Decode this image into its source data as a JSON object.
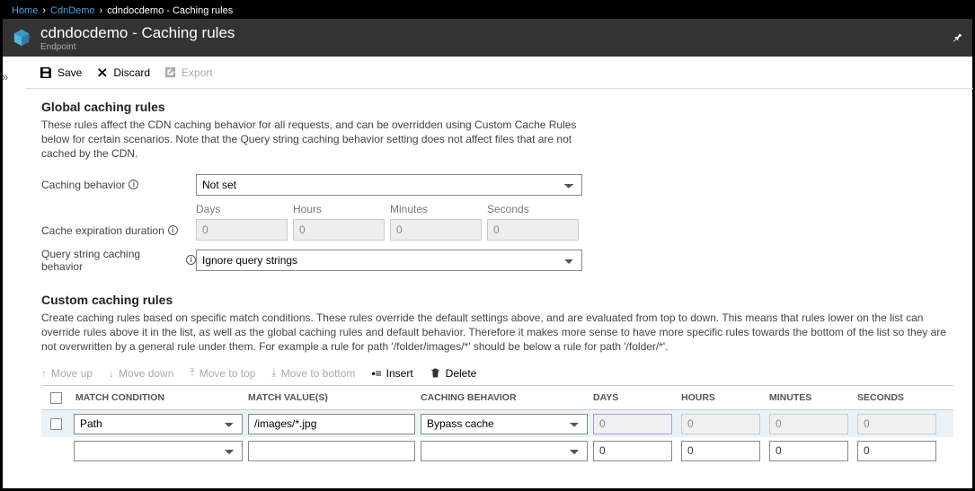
{
  "breadcrumb": {
    "home": "Home",
    "profile": "CdnDemo",
    "current": "cdndocdemo - Caching rules"
  },
  "header": {
    "title": "cdndocdemo - Caching rules",
    "subtitle": "Endpoint"
  },
  "toolbar": {
    "save": "Save",
    "discard": "Discard",
    "export": "Export"
  },
  "global": {
    "title": "Global caching rules",
    "desc": "These rules affect the CDN caching behavior for all requests, and can be overridden using Custom Cache Rules below for certain scenarios. Note that the Query string caching behavior setting does not affect files that are not cached by the CDN.",
    "caching_behavior_label": "Caching behavior",
    "caching_behavior_value": "Not set",
    "expiration_label": "Cache expiration duration",
    "duration_headers": {
      "days": "Days",
      "hours": "Hours",
      "minutes": "Minutes",
      "seconds": "Seconds"
    },
    "duration_values": {
      "days": "0",
      "hours": "0",
      "minutes": "0",
      "seconds": "0"
    },
    "query_label": "Query string caching behavior",
    "query_value": "Ignore query strings"
  },
  "custom": {
    "title": "Custom caching rules",
    "desc": "Create caching rules based on specific match conditions. These rules override the default settings above, and are evaluated from top to down. This means that rules lower on the list can override rules above it in the list, as well as the global caching rules and default behavior. Therefore it makes more sense to have more specific rules towards the bottom of the list so they are not overwritten by a general rule under them. For example a rule for path '/folder/images/*' should be below a rule for path '/folder/*'.",
    "buttons": {
      "move_up": "Move up",
      "move_down": "Move down",
      "move_top": "Move to top",
      "move_bottom": "Move to bottom",
      "insert": "Insert",
      "delete": "Delete"
    },
    "columns": {
      "match_condition": "MATCH CONDITION",
      "match_values": "MATCH VALUE(S)",
      "caching_behavior": "CACHING BEHAVIOR",
      "days": "DAYS",
      "hours": "HOURS",
      "minutes": "MINUTES",
      "seconds": "SECONDS"
    },
    "rows": [
      {
        "match_condition": "Path",
        "match_value": "/images/*.jpg",
        "caching_behavior": "Bypass cache",
        "days": "0",
        "hours": "0",
        "minutes": "0",
        "seconds": "0",
        "disabled": true
      },
      {
        "match_condition": "",
        "match_value": "",
        "caching_behavior": "",
        "days": "0",
        "hours": "0",
        "minutes": "0",
        "seconds": "0",
        "disabled": false
      }
    ]
  }
}
